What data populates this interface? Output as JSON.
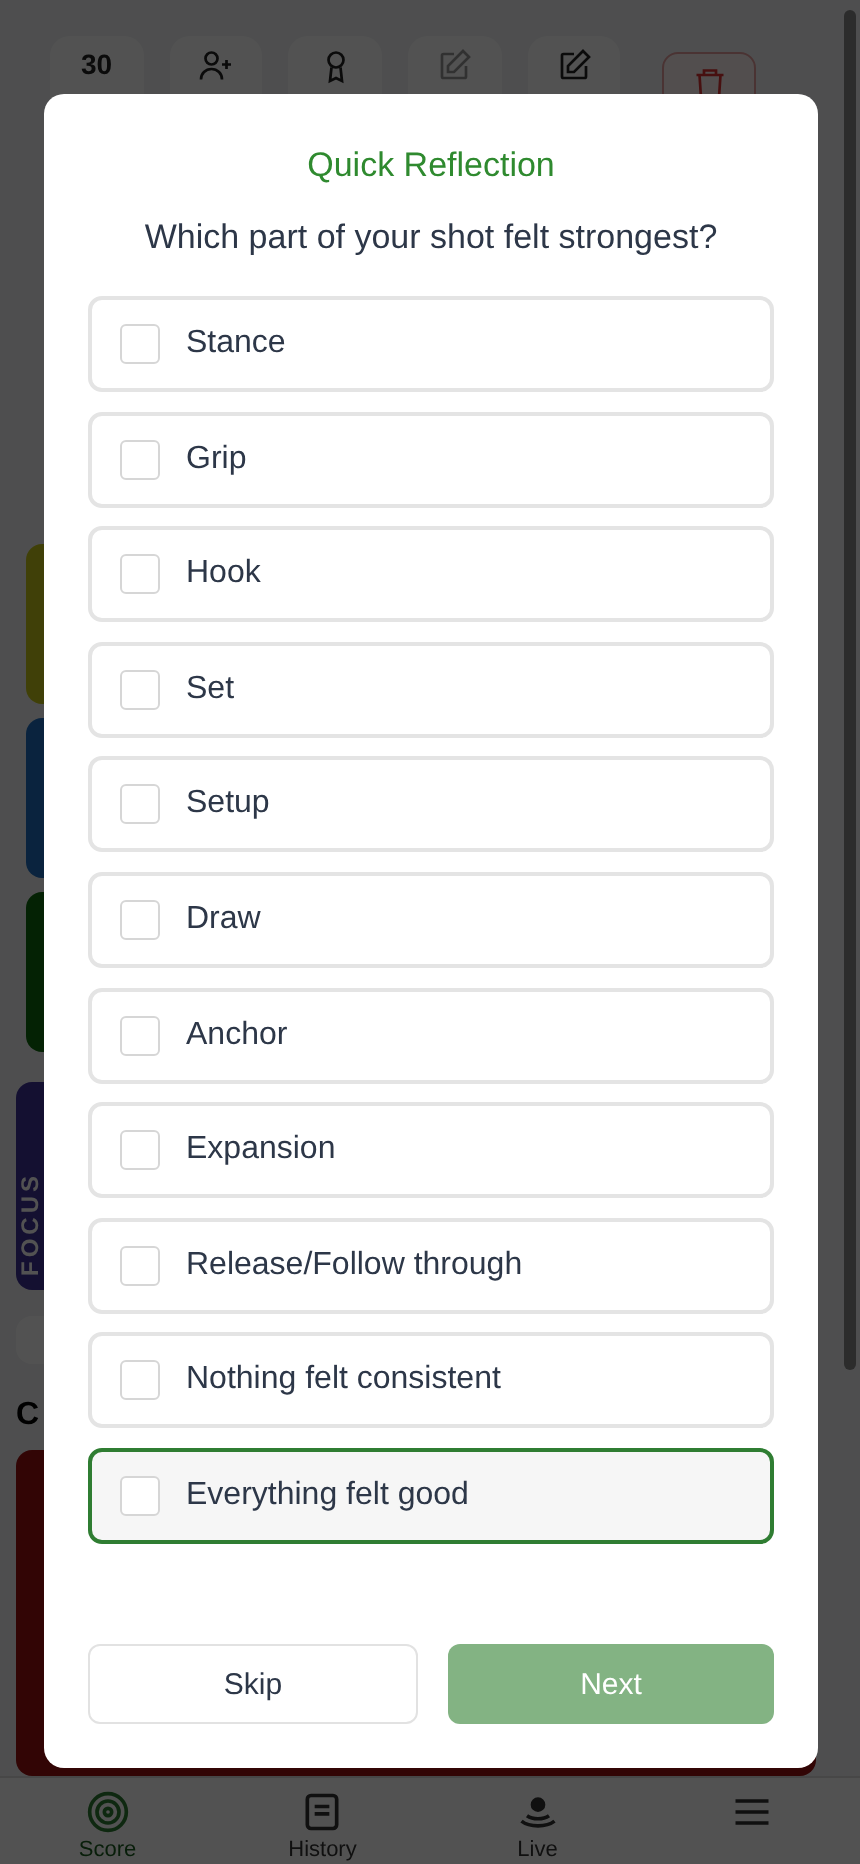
{
  "toolbar": {
    "count": "30"
  },
  "focus_card": {
    "label": "FOCUS"
  },
  "section": {
    "heading": "C"
  },
  "bottom_nav": [
    {
      "label": "Score",
      "selected": true
    },
    {
      "label": "History",
      "selected": false
    },
    {
      "label": "Live",
      "selected": false
    },
    {
      "selected": false
    }
  ],
  "dialog": {
    "title": "Quick Reflection",
    "question": "Which part of your shot felt strongest?",
    "options": [
      {
        "label": "Stance",
        "checked": false,
        "selected": false
      },
      {
        "label": "Grip",
        "checked": false,
        "selected": false
      },
      {
        "label": "Hook",
        "checked": false,
        "selected": false
      },
      {
        "label": "Set",
        "checked": false,
        "selected": false
      },
      {
        "label": "Setup",
        "checked": false,
        "selected": false
      },
      {
        "label": "Draw",
        "checked": false,
        "selected": false
      },
      {
        "label": "Anchor",
        "checked": false,
        "selected": false
      },
      {
        "label": "Expansion",
        "checked": false,
        "selected": false
      },
      {
        "label": "Release/Follow through",
        "checked": false,
        "selected": false
      },
      {
        "label": "Nothing felt consistent",
        "checked": false,
        "selected": false
      },
      {
        "label": "Everything felt good",
        "checked": false,
        "selected": true
      }
    ],
    "buttons": [
      {
        "label": "Skip",
        "kind": "secondary",
        "disabled": false
      },
      {
        "label": "Next",
        "kind": "primary",
        "disabled": true
      }
    ]
  }
}
